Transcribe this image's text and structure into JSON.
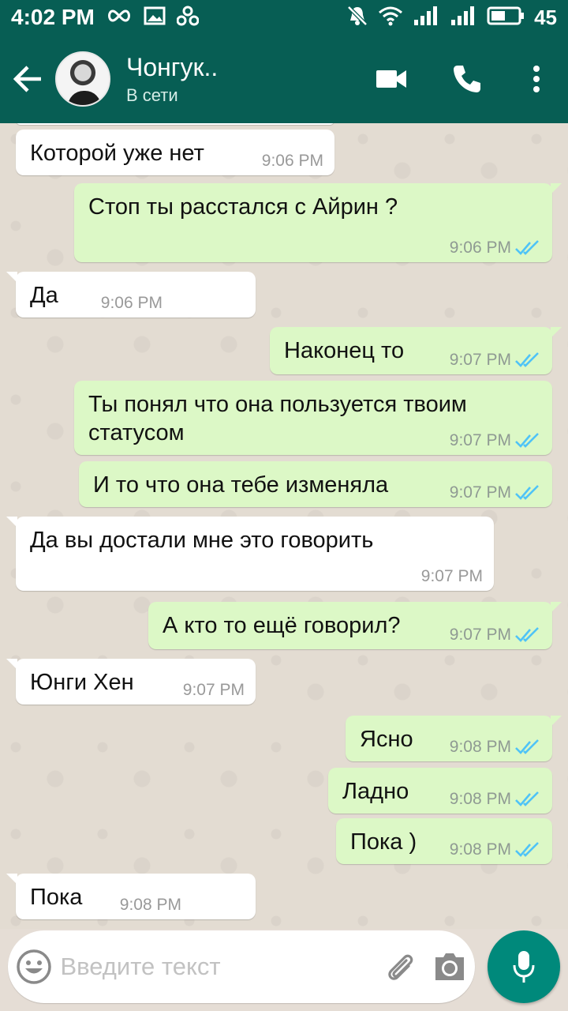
{
  "status_bar": {
    "time": "4:02 PM",
    "battery": "45"
  },
  "header": {
    "contact_name": "Чонгук..",
    "contact_status": "В сети"
  },
  "messages": [
    {
      "dir": "in",
      "text": "Которой уже нет",
      "time": "9:06 PM"
    },
    {
      "dir": "out",
      "text": "Стоп ты расстался с Айрин ?",
      "time": "9:06 PM"
    },
    {
      "dir": "in",
      "text": "Да",
      "time": "9:06 PM"
    },
    {
      "dir": "out",
      "text": "Наконец то",
      "time": "9:07 PM"
    },
    {
      "dir": "out",
      "text": "Ты понял что она пользуется твоим статусом",
      "time": "9:07 PM"
    },
    {
      "dir": "out",
      "text": "И то что она тебе изменяла",
      "time": "9:07 PM"
    },
    {
      "dir": "in",
      "text": "Да вы достали мне это говорить",
      "time": "9:07 PM"
    },
    {
      "dir": "out",
      "text": "А кто то ещё говорил?",
      "time": "9:07 PM"
    },
    {
      "dir": "in",
      "text": "Юнги Хен",
      "time": "9:07 PM"
    },
    {
      "dir": "out",
      "text": "Ясно",
      "time": "9:08 PM"
    },
    {
      "dir": "out",
      "text": "Ладно",
      "time": "9:08 PM"
    },
    {
      "dir": "out",
      "text": "Пока )",
      "time": "9:08 PM"
    },
    {
      "dir": "in",
      "text": "Пока",
      "time": "9:08 PM"
    }
  ],
  "composer": {
    "placeholder": "Введите текст"
  },
  "colors": {
    "header": "#075e54",
    "outgoing_bubble": "#dcf8c6",
    "incoming_bubble": "#ffffff",
    "read_ticks": "#4fc3f7",
    "mic_button": "#00897b"
  }
}
